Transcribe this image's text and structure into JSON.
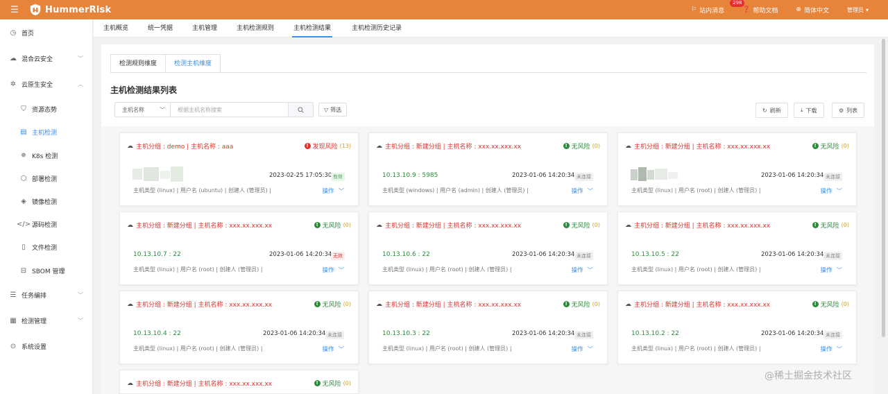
{
  "topbar": {
    "app_name": "HummerRisk",
    "messages_label": "站内消息",
    "messages_count": "298",
    "help_label": "帮助文档",
    "lang_label": "简体中文",
    "user_label": "管理员"
  },
  "sidebar": {
    "items": [
      {
        "label": "首页",
        "icon": "clock-icon"
      },
      {
        "label": "混合云安全",
        "icon": "cloud-icon"
      },
      {
        "label": "云原生安全",
        "icon": "cloud-native-icon"
      },
      {
        "label": "资源态势",
        "icon": "shield-icon"
      },
      {
        "label": "主机检测",
        "icon": "host-icon"
      },
      {
        "label": "K8s 检测",
        "icon": "k8s-icon"
      },
      {
        "label": "部署检测",
        "icon": "deploy-icon"
      },
      {
        "label": "镜像检测",
        "icon": "image-icon"
      },
      {
        "label": "源码检测",
        "icon": "code-icon"
      },
      {
        "label": "文件检测",
        "icon": "file-icon"
      },
      {
        "label": "SBOM 管理",
        "icon": "sbom-icon"
      },
      {
        "label": "任务编排",
        "icon": "list-icon"
      },
      {
        "label": "检测管理",
        "icon": "grid-icon"
      },
      {
        "label": "系统设置",
        "icon": "settings-icon"
      }
    ]
  },
  "tabs": [
    "主机概览",
    "统一凭据",
    "主机管理",
    "主机检测规则",
    "主机检测结果",
    "主机检测历史记录"
  ],
  "subtabs": [
    "检测规则维度",
    "检测主机维度"
  ],
  "list_title": "主机检测结果列表",
  "search": {
    "select_value": "主机名称",
    "placeholder": "根据主机名称搜索"
  },
  "filter_label": "筛选",
  "toolbar": {
    "refresh": "刷新",
    "download": "下载",
    "columns": "列表"
  },
  "cards": [
    {
      "title": "主机分组 : demo | 主机名称 : aaa",
      "risk": "发现风险",
      "count": "(13)",
      "addr": "",
      "date": "2023-02-25 17:05:30",
      "status": "有效",
      "meta": "主机类型 (linux) | 用户名 (ubuntu) | 创建人 (管理员) |",
      "op": "操作"
    },
    {
      "title": "主机分组 : 新建分组 | 主机名称 : xxx.xx.xxx.xx",
      "risk": "无风险",
      "count": "(0)",
      "addr": "10.13.10.9 : 5985",
      "date": "2023-01-06 14:20:34",
      "status": "未连接",
      "meta": "主机类型 (windows) | 用户名 (admin) | 创建人 (管理员) |",
      "op": "操作"
    },
    {
      "title": "主机分组 : 新建分组 | 主机名称 : xxx.xx.xxx.xx",
      "risk": "无风险",
      "count": "(0)",
      "addr": "",
      "date": "2023-01-06 14:20:34",
      "status": "未连接",
      "meta": "主机类型 (linux) | 用户名 (root) | 创建人 (管理员) |",
      "op": "操作"
    },
    {
      "title": "主机分组 : 新建分组 | 主机名称 : xxx.xx.xxx.xx",
      "risk": "无风险",
      "count": "(0)",
      "addr": "10.13.10.7 : 22",
      "date": "2023-01-06 14:20:34",
      "status": "无效",
      "meta": "主机类型 (linux) | 用户名 (root) | 创建人 (管理员) |",
      "op": "操作"
    },
    {
      "title": "主机分组 : 新建分组 | 主机名称 : xxx.xx.xxx.xx",
      "risk": "无风险",
      "count": "(0)",
      "addr": "10.13.10.6 : 22",
      "date": "2023-01-06 14:20:34",
      "status": "未连接",
      "meta": "主机类型 (linux) | 用户名 (root) | 创建人 (管理员) |",
      "op": "操作"
    },
    {
      "title": "主机分组 : 新建分组 | 主机名称 : xxx.xx.xxx.xx",
      "risk": "无风险",
      "count": "(0)",
      "addr": "10.13.10.5 : 22",
      "date": "2023-01-06 14:20:34",
      "status": "未连接",
      "meta": "主机类型 (linux) | 用户名 (root) | 创建人 (管理员) |",
      "op": "操作"
    },
    {
      "title": "主机分组 : 新建分组 | 主机名称 : xxx.xx.xxx.xx",
      "risk": "无风险",
      "count": "(0)",
      "addr": "10.13.10.4 : 22",
      "date": "2023-01-06 14:20:34",
      "status": "未连接",
      "meta": "主机类型 (linux) | 用户名 (root) | 创建人 (管理员) |",
      "op": "操作"
    },
    {
      "title": "主机分组 : 新建分组 | 主机名称 : xxx.xx.xxx.xx",
      "risk": "无风险",
      "count": "(0)",
      "addr": "10.13.10.3 : 22",
      "date": "2023-01-06 14:20:34",
      "status": "未连接",
      "meta": "主机类型 (linux) | 用户名 (root) | 创建人 (管理员) |",
      "op": "操作"
    },
    {
      "title": "主机分组 : 新建分组 | 主机名称 : xxx.xx.xxx.xx",
      "risk": "无风险",
      "count": "(0)",
      "addr": "10.13.10.2 : 22",
      "date": "2023-01-06 14:20:34",
      "status": "未连接",
      "meta": "主机类型 (linux) | 用户名 (root) | 创建人 (管理员) |",
      "op": "操作"
    },
    {
      "title": "主机分组 : 新建分组 | 主机名称 : xxx.xx.xxx.xx",
      "risk": "无风险",
      "count": "(0)",
      "addr": "",
      "date": "",
      "status": "",
      "meta": "",
      "op": ""
    }
  ],
  "watermark": "@稀土掘金技术社区",
  "colors": {
    "brand": "#e8833a",
    "accent": "#3a8ee6",
    "danger": "#e0312c",
    "ok": "#2a8a3a"
  }
}
